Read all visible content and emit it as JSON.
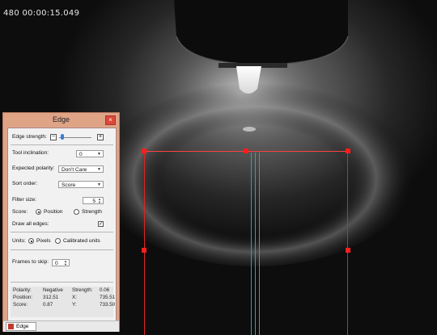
{
  "overlay": {
    "timestamp": "480 00:00:15.049"
  },
  "panel": {
    "title": "Edge",
    "close_glyph": "×",
    "edge_strength_label": "Edge strength:",
    "edge_strength_minus": "−",
    "edge_strength_plus": "+",
    "edge_strength_level": 0.05,
    "tool_inclination_label": "Tool inclination:",
    "tool_inclination_value": "0",
    "expected_polarity_label": "Expected polarity:",
    "expected_polarity_value": "Don't Care",
    "sort_order_label": "Sort order:",
    "sort_order_value": "Score",
    "filter_size_label": "Filter size:",
    "filter_size_value": "5",
    "score_label": "Score:",
    "score_option_position": "Position",
    "score_option_strength": "Strength",
    "score_selected": "Position",
    "draw_all_edges_label": "Draw all edges:",
    "draw_all_edges_checked": true,
    "units_label": "Units:",
    "units_option_pixels": "Pixels",
    "units_option_calibrated": "Calibrated units",
    "units_selected": "Pixels",
    "frames_to_skip_label": "Frames to skip:",
    "frames_to_skip_value": "0",
    "stats": {
      "polarity_label": "Polarity:",
      "polarity_value": "Negative",
      "strength_label": "Strength:",
      "strength_value": "0.06",
      "position_label": "Position:",
      "position_value": "312.51",
      "x_label": "X:",
      "x_value": "735.51",
      "score_label": "Score:",
      "score_value": "0.87",
      "y_label": "Y:",
      "y_value": "733.50"
    },
    "tab_label": "Edge"
  },
  "colors": {
    "roi": "#e02323",
    "edge_line": "#2fa3a3",
    "panel_frame": "#dfa386"
  }
}
